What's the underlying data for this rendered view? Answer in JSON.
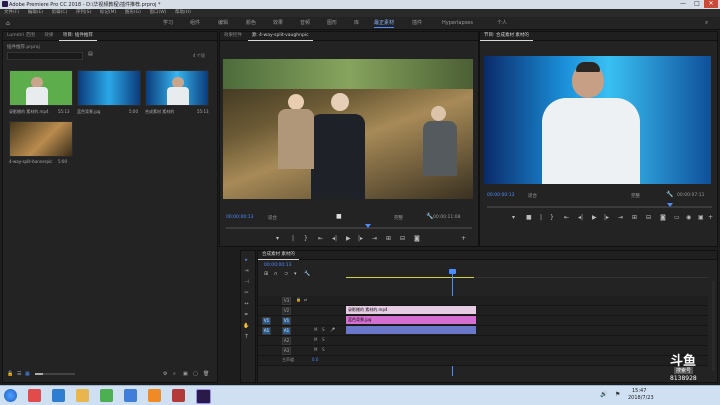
{
  "window": {
    "title": "Adobe Premiere Pro CC 2018 - D:\\华视频教程\\插件推荐.prproj *",
    "controls": [
      "—",
      "□",
      "✕"
    ]
  },
  "menubar": [
    "文件(F)",
    "编辑(E)",
    "剪辑(C)",
    "序列(S)",
    "标记(M)",
    "图形(G)",
    "窗口(W)",
    "帮助(H)"
  ],
  "workspaces": [
    {
      "label": "学习",
      "active": false
    },
    {
      "label": "组件",
      "active": false
    },
    {
      "label": "编辑",
      "active": false
    },
    {
      "label": "颜色",
      "active": false
    },
    {
      "label": "效果",
      "active": false
    },
    {
      "label": "音频",
      "active": false
    },
    {
      "label": "图形",
      "active": false
    },
    {
      "label": "库",
      "active": false
    },
    {
      "label": "最正素材",
      "active": true
    },
    {
      "label": "插件",
      "active": false
    },
    {
      "label": "Hyperlapses",
      "active": false
    },
    {
      "label": "个人",
      "active": false
    }
  ],
  "project_panel": {
    "tabs": [
      {
        "label": "Lumetri 范围",
        "active": false
      },
      {
        "label": "效果",
        "active": false
      },
      {
        "label": "项目: 插件推荐",
        "active": true
      }
    ],
    "project_name": "插件推荐.prproj",
    "item_count": "4 个项",
    "items": [
      {
        "label": "录影棚的 素材的.mp4",
        "duration": "55:13",
        "kind": "green"
      },
      {
        "label": "蓝色背景.jpg",
        "duration": "5:00",
        "kind": "blue"
      },
      {
        "label": "合成素材 素材的",
        "duration": "55:13",
        "kind": "composite"
      },
      {
        "label": "4-way-split-bannerpic",
        "duration": "5:00",
        "kind": "warm"
      }
    ]
  },
  "source_monitor": {
    "tabs": [
      {
        "label": "效果控件",
        "active": false
      },
      {
        "label": "源: 4-way-split-vaughnpic",
        "active": true
      }
    ],
    "timecode_in": "00:00:00:13",
    "fit": "适合",
    "quality": "完整",
    "timecode_out": "00:00:11:08"
  },
  "program_monitor": {
    "tabs": [
      {
        "label": "节目: 合成素材 素材的",
        "active": true
      }
    ],
    "timecode_in": "00:00:00:13",
    "fit": "适合",
    "quality": "完整",
    "timecode_out": "00:00:07:11"
  },
  "timeline": {
    "tab": "合成素材 素材的",
    "timecode": "00:00:00:13",
    "tracks": [
      {
        "name": "V3",
        "toggle": "V3"
      },
      {
        "name": "V2",
        "toggle": "V2"
      },
      {
        "name": "V1",
        "toggle": "V1"
      },
      {
        "name": "A1",
        "toggle": "A1"
      },
      {
        "name": "A2",
        "toggle": "A2"
      },
      {
        "name": "A3",
        "toggle": "A3"
      },
      {
        "name": "主声道",
        "toggle": "0.0"
      }
    ],
    "clips": [
      {
        "label": "录影棚的 素材的.mp4",
        "color": "#e6cde4"
      },
      {
        "label": "蓝色背景.jpg",
        "color": "#d46fd1"
      },
      {
        "label": "",
        "color": "#6b78c9"
      }
    ]
  },
  "watermark": {
    "brand": "斗鱼",
    "sub": "搜索号",
    "room": "8138928"
  },
  "clock": {
    "time": "15:47",
    "date": "2018/7/23"
  }
}
